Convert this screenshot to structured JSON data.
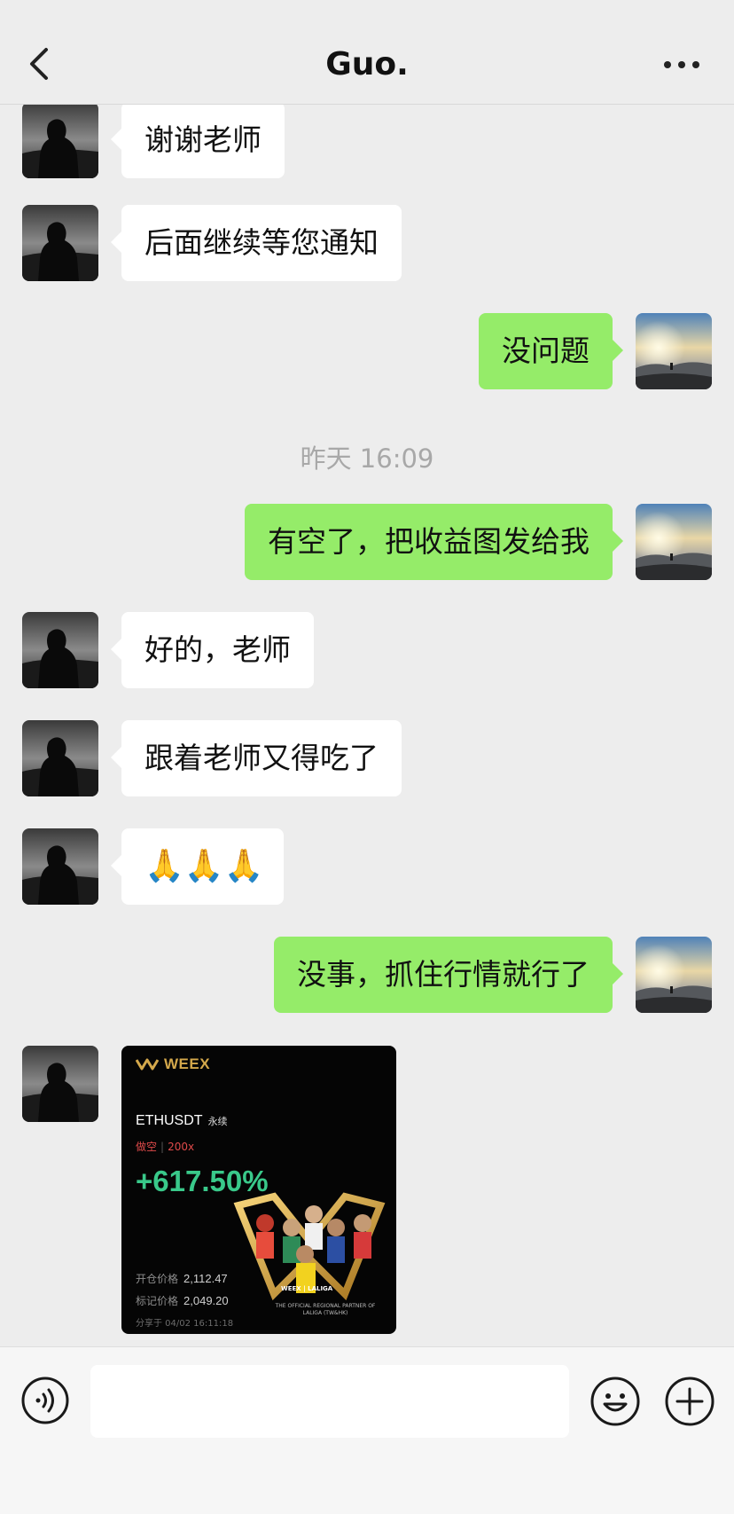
{
  "header": {
    "title": "Guo.",
    "back_icon": "chevron-left-icon",
    "more_icon": "more-dots-icon"
  },
  "messages": [
    {
      "side": "left",
      "text": "谢谢老师"
    },
    {
      "side": "left",
      "text": "后面继续等您通知"
    },
    {
      "side": "right",
      "text": "没问题"
    },
    {
      "timestamp": "昨天 16:09"
    },
    {
      "side": "right",
      "text": "有空了，把收益图发给我"
    },
    {
      "side": "left",
      "text": "好的，老师"
    },
    {
      "side": "left",
      "text": "跟着老师又得吃了"
    },
    {
      "side": "left",
      "emoji": "🙏🙏🙏"
    },
    {
      "side": "right",
      "text": "没事，抓住行情就行了"
    },
    {
      "side": "left",
      "card": "trade"
    }
  ],
  "trade_card": {
    "brand": "WEEX",
    "pair": "ETHUSDT",
    "pair_type": "永续",
    "side": "做空",
    "leverage": "200x",
    "pnl": "+617.50%",
    "open_label": "开仓价格",
    "open_value": "2,112.47",
    "mark_label": "标记价格",
    "mark_value": "2,049.20",
    "shared_at": "分享于 04/02 16:11:18",
    "partner_brand": "WEEX | LALIGA",
    "partner_text": "THE OFFICIAL REGIONAL PARTNER OF LALIGA (TW&HK)",
    "accent_color": "#39c98a",
    "brand_color": "#d4a84b"
  },
  "input_bar": {
    "voice_icon": "voice-icon",
    "emoji_icon": "emoji-icon",
    "plus_icon": "plus-icon"
  },
  "colors": {
    "self_bubble": "#95ec69",
    "other_bubble": "#ffffff",
    "background": "#ededed"
  }
}
